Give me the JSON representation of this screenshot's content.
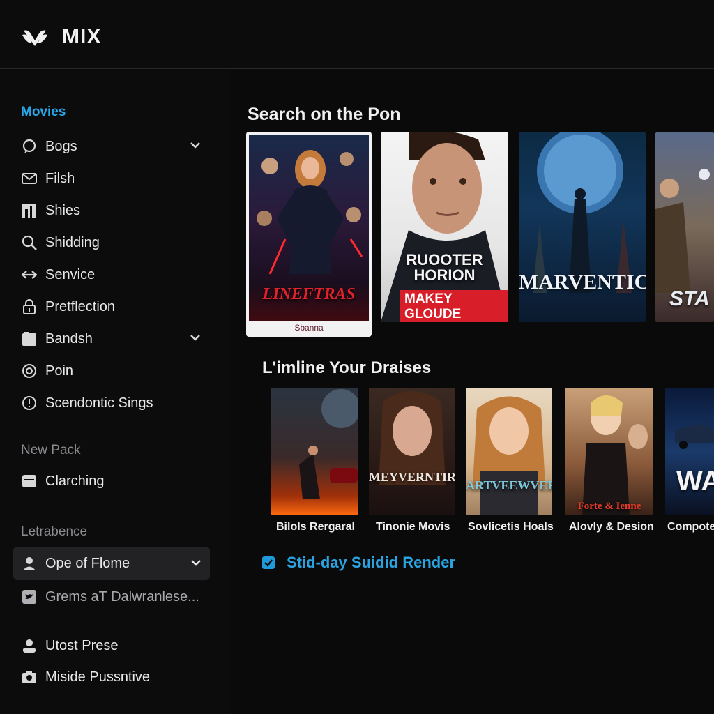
{
  "app": {
    "title": "MIX",
    "logo_icon": "winged-logo-icon"
  },
  "sidebar": {
    "heading": "Movies",
    "items": [
      {
        "label": "Bogs",
        "icon": "chat-bubble-icon",
        "has_chevron": true
      },
      {
        "label": "Filsh",
        "icon": "mail-icon",
        "has_chevron": false
      },
      {
        "label": "Shies",
        "icon": "grid-tile-icon",
        "has_chevron": false
      },
      {
        "label": "Shidding",
        "icon": "search-icon",
        "has_chevron": false
      },
      {
        "label": "Senvice",
        "icon": "arrows-icon",
        "has_chevron": false
      },
      {
        "label": "Pretflection",
        "icon": "lock-icon",
        "has_chevron": false
      },
      {
        "label": "Bandsh",
        "icon": "folder-icon",
        "has_chevron": true
      },
      {
        "label": "Poin",
        "icon": "globe-icon",
        "has_chevron": false
      },
      {
        "label": "Scendontic Sings",
        "icon": "alert-circle-icon",
        "has_chevron": false
      }
    ],
    "section2": {
      "label": "New Pack",
      "items": [
        {
          "label": "Clarching",
          "icon": "card-icon"
        }
      ]
    },
    "section3": {
      "label": "Letrabence",
      "active_item": {
        "label": "Ope of Flome",
        "icon": "user-icon",
        "has_chevron": true
      },
      "muted_item": {
        "label": "Grems aT Dalwranlese...",
        "icon": "bird-icon"
      }
    },
    "bottom_items": [
      {
        "label": "Utost Prese",
        "icon": "person-icon"
      },
      {
        "label": "Miside Pussntive",
        "icon": "camera-icon"
      }
    ]
  },
  "main": {
    "section1_title": "Search on the Pon",
    "row1": [
      {
        "title": "LINEFTRAS",
        "subtitle": "Sbanna",
        "selected": true,
        "accent": "#c8202a"
      },
      {
        "title": "RUOOTER HORION",
        "subtitle": "MAKEY GLOUDE",
        "selected": false,
        "accent": "#d81e28"
      },
      {
        "title": "MARVENTIC",
        "subtitle": "",
        "selected": false,
        "accent": "#9fc4e6"
      },
      {
        "title": "STA",
        "subtitle": "",
        "selected": false,
        "accent": "#c9b07a"
      }
    ],
    "section2_title": "L'imline Your Draises",
    "row2": [
      {
        "title": "",
        "caption": "Bilols Rergaral"
      },
      {
        "title": "MEYVERNTIR",
        "caption": "Tinonie Movis"
      },
      {
        "title": "ARTVEEWVER",
        "caption": "Sovlicetis Hoals"
      },
      {
        "title": "Forte & Ienne",
        "caption": "Alovly & Desion"
      },
      {
        "title": "WAI",
        "caption": "Compote"
      }
    ],
    "checkbox": {
      "label": "Stid-day Suidid Render",
      "checked": true
    }
  },
  "colors": {
    "accent": "#28a8e8",
    "background": "#0a0a0b",
    "panel": "#0c0c0d",
    "active_row": "#222224"
  }
}
